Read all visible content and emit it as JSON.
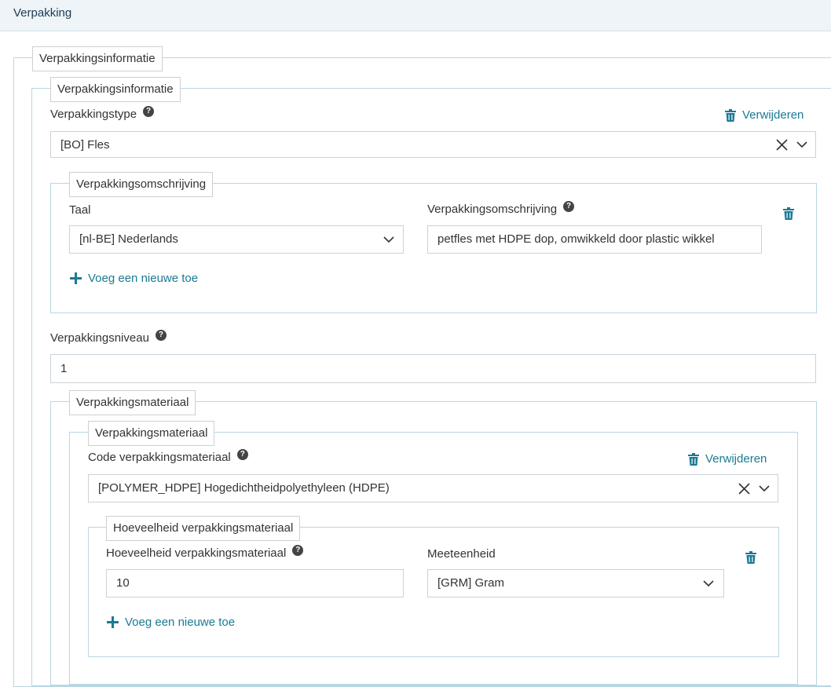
{
  "header": {
    "title": "Verpakking"
  },
  "outer": {
    "legend": "Verpakkingsinformatie"
  },
  "info": {
    "legend": "Verpakkingsinformatie",
    "type_label": "Verpakkingstype",
    "remove_label": "Verwijderen",
    "type_value": "[BO] Fles"
  },
  "description": {
    "legend": "Verpakkingsomschrijving",
    "language_label": "Taal",
    "language_value": "[nl-BE] Nederlands",
    "text_label": "Verpakkingsomschrijving",
    "text_value": "petfles met HDPE dop, omwikkeld door plastic wikkel",
    "add_label": "Voeg een nieuwe toe"
  },
  "level": {
    "label": "Verpakkingsniveau",
    "value": "1"
  },
  "material_outer": {
    "legend": "Verpakkingsmateriaal"
  },
  "material": {
    "legend": "Verpakkingsmateriaal",
    "code_label": "Code verpakkingsmateriaal",
    "remove_label": "Verwijderen",
    "code_value": "[POLYMER_HDPE] Hogedichtheidpolyethyleen (HDPE)"
  },
  "quantity": {
    "legend": "Hoeveelheid verpakkingsmateriaal",
    "amount_label": "Hoeveelheid verpakkingsmateriaal",
    "amount_value": "10",
    "unit_label": "Meeteenheid",
    "unit_value": "[GRM] Gram",
    "add_label": "Voeg een nieuwe toe"
  },
  "help_glyph": "?",
  "colors": {
    "accent": "#1a7a94",
    "border": "#b9d6e3",
    "header_bg": "#eef4f8"
  }
}
